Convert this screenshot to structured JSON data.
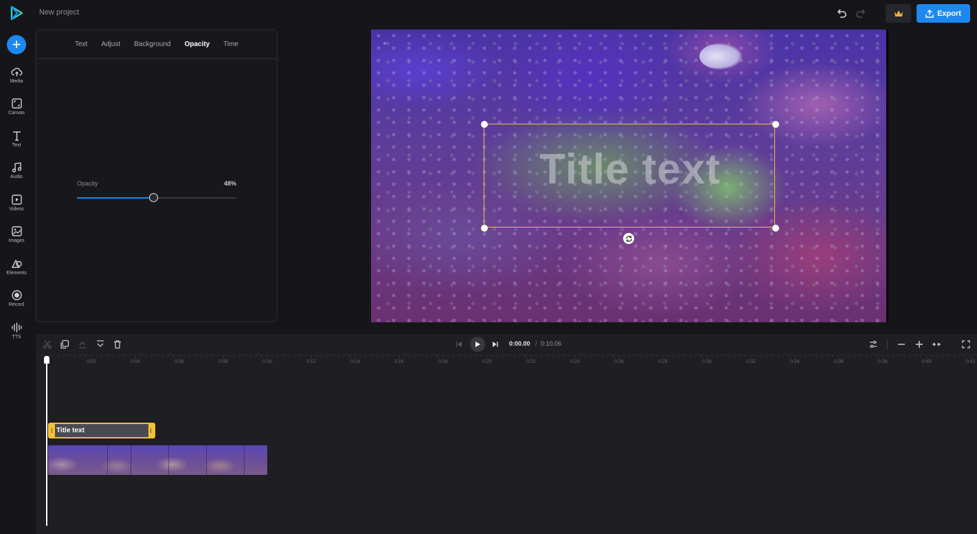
{
  "app": {
    "project_title": "New project",
    "export_label": "Export"
  },
  "sidebar": {
    "items": [
      {
        "label": "Media",
        "icon": "cloud-upload-icon"
      },
      {
        "label": "Canvas",
        "icon": "canvas-icon"
      },
      {
        "label": "Text",
        "icon": "text-icon"
      },
      {
        "label": "Audio",
        "icon": "music-note-icon"
      },
      {
        "label": "Videos",
        "icon": "video-play-icon"
      },
      {
        "label": "Images",
        "icon": "image-icon"
      },
      {
        "label": "Elements",
        "icon": "shapes-icon"
      },
      {
        "label": "Record",
        "icon": "record-icon"
      },
      {
        "label": "TTS",
        "icon": "sound-wave-icon"
      }
    ]
  },
  "panel": {
    "tabs": [
      "Text",
      "Adjust",
      "Background",
      "Opacity",
      "Time"
    ],
    "active_tab": "Opacity",
    "opacity_label": "Opacity",
    "opacity_value_text": "48%",
    "opacity_fraction": 0.48
  },
  "preview": {
    "overlay_text": "Title text"
  },
  "timeline": {
    "current_time": "0:00.00",
    "separator": "/",
    "total_time": "0:10.06",
    "ruler_ticks": [
      "0",
      "0:02",
      "0:04",
      "0:06",
      "0:08",
      "0:10",
      "0:12",
      "0:14",
      "0:16",
      "0:18",
      "0:20",
      "0:22",
      "0:24",
      "0:26",
      "0:28",
      "0:30",
      "0:32",
      "0:34",
      "0:36",
      "0:38",
      "0:40",
      "0:42"
    ],
    "text_clip_label": "Title text"
  },
  "colors": {
    "accent": "#1e88f0",
    "selection": "#f1c232",
    "background": "#16161a"
  }
}
